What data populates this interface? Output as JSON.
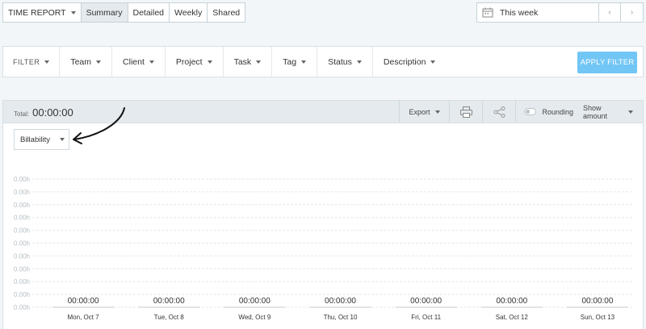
{
  "top_tabs": {
    "report_menu": "TIME REPORT",
    "tabs": [
      "Summary",
      "Detailed",
      "Weekly",
      "Shared"
    ]
  },
  "date_range": {
    "label": "This week",
    "prev": "‹",
    "next": "›"
  },
  "filters": {
    "label": "FILTER",
    "items": [
      "Team",
      "Client",
      "Project",
      "Task",
      "Tag",
      "Status",
      "Description"
    ],
    "apply": "APPLY FILTER"
  },
  "report": {
    "total_label": "Total:",
    "total_value": "00:00:00",
    "export": "Export",
    "rounding": "Rounding",
    "show_amount": "Show amount",
    "group_by": "Billability"
  },
  "colors": {
    "accent": "#72c6f5",
    "header_bg": "#e4eaee",
    "grid": "#e3e8ec"
  },
  "chart_data": {
    "type": "bar",
    "categories": [
      "Mon, Oct 7",
      "Tue, Oct 8",
      "Wed, Oct 9",
      "Thu, Oct 10",
      "Fri, Oct 11",
      "Sat, Oct 12",
      "Sun, Oct 13"
    ],
    "values": [
      0,
      0,
      0,
      0,
      0,
      0,
      0
    ],
    "bar_labels": [
      "00:00:00",
      "00:00:00",
      "00:00:00",
      "00:00:00",
      "00:00:00",
      "00:00:00",
      "00:00:00"
    ],
    "ytick_labels": [
      "0.00h",
      "0.00h",
      "0.00h",
      "0.00h",
      "0.00h",
      "0.00h",
      "0.00h",
      "0.00h",
      "0.00h",
      "0.00h",
      "0.00h"
    ],
    "grid": true
  }
}
